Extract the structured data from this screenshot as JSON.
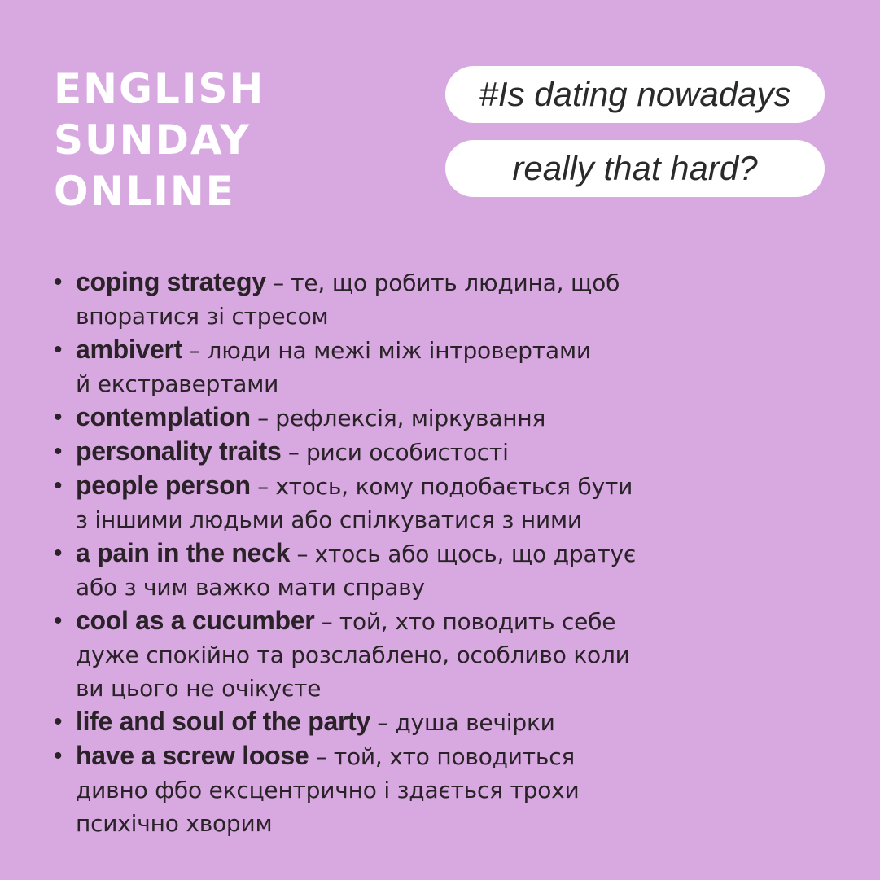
{
  "brand": {
    "lines": [
      "ENGLISH",
      "SUNDAY",
      "ONLINE"
    ]
  },
  "hashtag": {
    "line1": "#Is dating nowadays",
    "line2": "really that hard?"
  },
  "glossary": [
    {
      "term": "coping strategy",
      "dash": "–",
      "def": [
        "те, що робить людина, щоб",
        "впоратися зі стресом"
      ]
    },
    {
      "term": "ambivert",
      "dash": "–",
      "def": [
        "люди на межі між інтровертами",
        "й екстравертами"
      ]
    },
    {
      "term": "contemplation",
      "dash": "–",
      "def": [
        "рефлексія, міркування"
      ]
    },
    {
      "term": "personality traits",
      "dash": "–",
      "def": [
        "риси особистості"
      ]
    },
    {
      "term": "people person",
      "dash": "–",
      "def": [
        "хтось, кому подобається бути",
        "з іншими людьми або спілкуватися з ними"
      ]
    },
    {
      "term": "a pain in the neck",
      "dash": "–",
      "def": [
        "хтось або щось, що дратує",
        "або з чим важко мати справу"
      ]
    },
    {
      "term": "cool as a cucumber",
      "dash": "–",
      "def": [
        "той, хто поводить себе",
        "дуже спокійно та розслаблено, особливо коли",
        "ви цього не очікуєте"
      ]
    },
    {
      "term": "life and soul of the party",
      "dash": "–",
      "def": [
        "душа вечірки"
      ]
    },
    {
      "term": "have a screw loose",
      "dash": "–",
      "def": [
        "той, хто поводиться",
        "дивно фбо ексцентрично і здається трохи",
        "психічно хворим"
      ]
    }
  ]
}
